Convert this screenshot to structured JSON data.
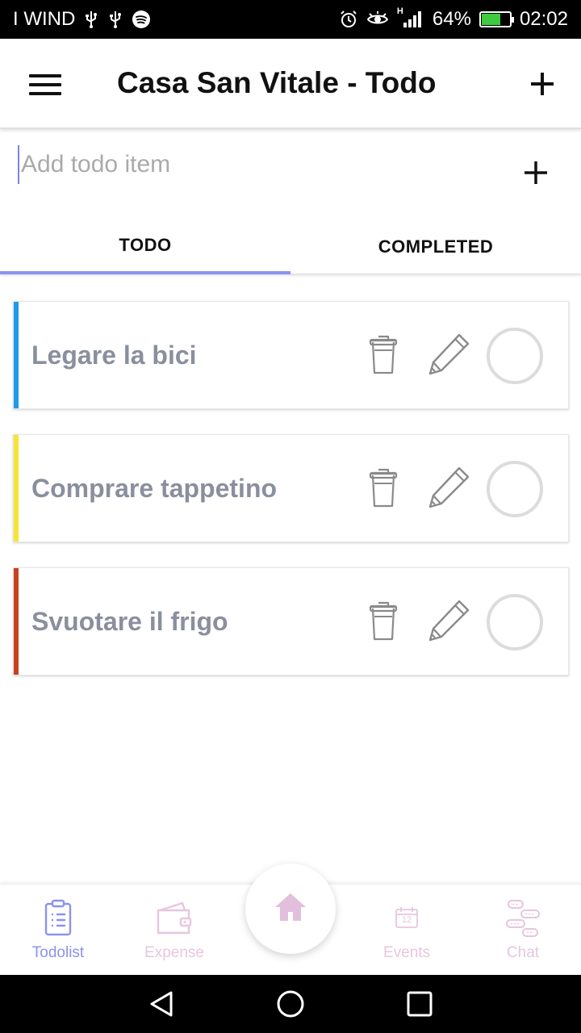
{
  "status_bar": {
    "carrier": "I WIND",
    "network": "H",
    "battery": "64%",
    "battery_level": 0.64,
    "time": "02:02",
    "icons": [
      "usb-icon",
      "usb-icon",
      "spotify-icon",
      "alarm-icon",
      "eye-icon",
      "signal-icon",
      "battery-icon"
    ]
  },
  "app_bar": {
    "title": "Casa San Vitale - Todo",
    "menu_icon": "hamburger-menu-icon",
    "add_icon": "plus-icon"
  },
  "add_todo": {
    "placeholder": "Add todo item",
    "value": "",
    "add_icon": "plus-icon"
  },
  "tabs": [
    {
      "label": "TODO",
      "active": true
    },
    {
      "label": "COMPLETED",
      "active": false
    }
  ],
  "todos": [
    {
      "text": "Legare la bici",
      "color": "#1e9be8"
    },
    {
      "text": "Comprare tappetino",
      "color": "#f7e433"
    },
    {
      "text": "Svuotare il frigo",
      "color": "#c8401e"
    }
  ],
  "bottom_nav": {
    "items": [
      {
        "label": "Todolist",
        "icon": "clipboard-list-icon",
        "color": "#8b92ee"
      },
      {
        "label": "Expense",
        "icon": "wallet-icon",
        "color": "#e7c6df"
      },
      {
        "label": "Events",
        "icon": "calendar-icon",
        "color": "#e7c6df",
        "icon_text": "12"
      },
      {
        "label": "Chat",
        "icon": "chat-bubbles-icon",
        "color": "#e7c6df"
      }
    ],
    "home_icon": "home-icon",
    "home_color": "#e2bfdc"
  },
  "colors": {
    "accent": "#8b92ee",
    "inactive": "#e7c6df",
    "todo_text": "#8a8f9e"
  }
}
